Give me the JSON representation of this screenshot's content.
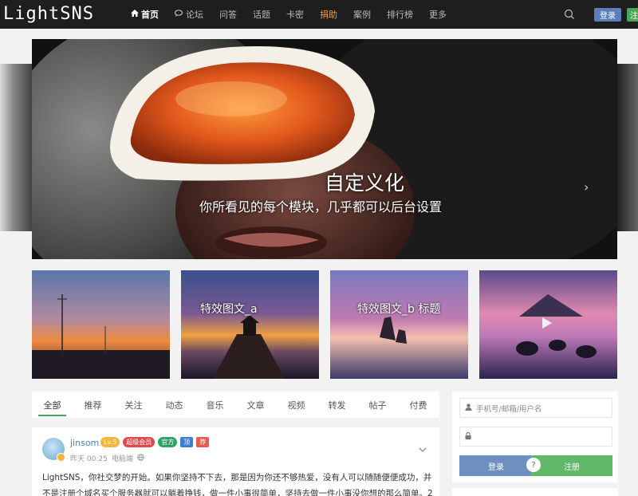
{
  "header": {
    "logo": "LightSNS",
    "nav": [
      {
        "label": "首页",
        "icon": "home-icon",
        "active": true
      },
      {
        "label": "论坛",
        "icon": "chat-icon"
      },
      {
        "label": "问答"
      },
      {
        "label": "话题"
      },
      {
        "label": "卡密"
      },
      {
        "label": "捐助",
        "highlight": true
      },
      {
        "label": "案例"
      },
      {
        "label": "排行榜"
      },
      {
        "label": "更多"
      }
    ],
    "login_label": "登录",
    "register_label": "注"
  },
  "hero": {
    "title": "自定义化",
    "subtitle": "你所看见的每个模块，几乎都可以后台设置",
    "next_icon": "›"
  },
  "cards": [
    {
      "label": ""
    },
    {
      "label": "特效图文_a"
    },
    {
      "label": "特效图文_b 标题"
    },
    {
      "label": "",
      "icon": "play-icon"
    }
  ],
  "feed": {
    "tabs": [
      "全部",
      "推荐",
      "关注",
      "动态",
      "音乐",
      "文章",
      "视频",
      "转发",
      "帖子",
      "付费"
    ],
    "post": {
      "username": "jinsom",
      "badges": [
        "Lv.5",
        "超级会员",
        "官方",
        "顶",
        "荐"
      ],
      "time": "昨天 00:25",
      "source": "电脑端",
      "text": "LightSNS，你社交梦的开始。如果你坚持不下去，那是因为你还不够热爱，没有人可以随随便便成功，并不是注册个域名买个服务器就可以躺着挣钱，做一件小事很简单，坚持去做一件小事没你想的那么简单。2"
    }
  },
  "login_box": {
    "username_placeholder": "手机号/邮箱/用户名",
    "password_placeholder": "",
    "login_button": "登录",
    "register_button": "注册",
    "or_symbol": "?"
  }
}
